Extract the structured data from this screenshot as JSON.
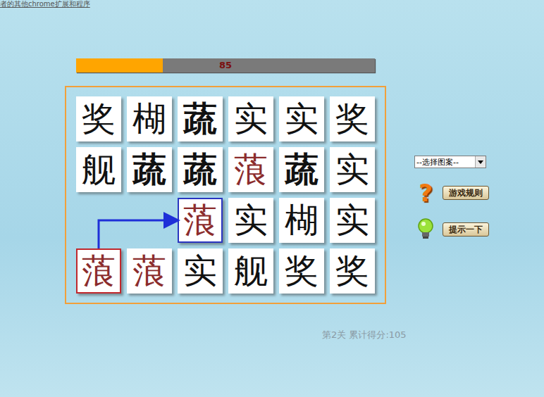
{
  "link": "者的其他chrome扩展和程序",
  "timer": {
    "level": 0.29,
    "reading": "85"
  },
  "board": {
    "columns": 6,
    "tiles": [
      {
        "kind": "tile",
        "char": "奖",
        "color": "#111111",
        "bold": false,
        "selected": false,
        "ring": ""
      },
      {
        "kind": "tile",
        "char": "楜",
        "color": "#111111",
        "bold": false,
        "selected": false,
        "ring": ""
      },
      {
        "kind": "tile",
        "char": "蔬",
        "color": "#111111",
        "bold": true,
        "selected": false,
        "ring": ""
      },
      {
        "kind": "tile",
        "char": "实",
        "color": "#111111",
        "bold": false,
        "selected": false,
        "ring": ""
      },
      {
        "kind": "tile",
        "char": "实",
        "color": "#111111",
        "bold": false,
        "selected": false,
        "ring": ""
      },
      {
        "kind": "tile",
        "char": "奖",
        "color": "#111111",
        "bold": false,
        "selected": false,
        "ring": ""
      },
      {
        "kind": "tile",
        "char": "舰",
        "color": "#111111",
        "bold": false,
        "selected": false,
        "ring": ""
      },
      {
        "kind": "tile",
        "char": "蔬",
        "color": "#111111",
        "bold": true,
        "selected": false,
        "ring": ""
      },
      {
        "kind": "tile",
        "char": "蔬",
        "color": "#111111",
        "bold": true,
        "selected": false,
        "ring": ""
      },
      {
        "kind": "tile",
        "char": "蒗",
        "color": "#8b2c2c",
        "bold": false,
        "selected": false,
        "ring": ""
      },
      {
        "kind": "tile",
        "char": "蔬",
        "color": "#111111",
        "bold": true,
        "selected": false,
        "ring": ""
      },
      {
        "kind": "tile",
        "char": "实",
        "color": "#111111",
        "bold": false,
        "selected": false,
        "ring": ""
      },
      {
        "kind": "empty",
        "char": "",
        "color": "",
        "bold": false,
        "selected": false,
        "ring": ""
      },
      {
        "kind": "empty",
        "char": "",
        "color": "",
        "bold": false,
        "selected": false,
        "ring": ""
      },
      {
        "kind": "tile",
        "char": "蒗",
        "color": "#8b2c2c",
        "bold": false,
        "selected": true,
        "ring": "#2a35c0"
      },
      {
        "kind": "tile",
        "char": "实",
        "color": "#111111",
        "bold": false,
        "selected": false,
        "ring": ""
      },
      {
        "kind": "tile",
        "char": "楜",
        "color": "#111111",
        "bold": false,
        "selected": false,
        "ring": ""
      },
      {
        "kind": "tile",
        "char": "实",
        "color": "#111111",
        "bold": false,
        "selected": false,
        "ring": ""
      },
      {
        "kind": "tile",
        "char": "蒗",
        "color": "#8b2c2c",
        "bold": false,
        "selected": true,
        "ring": "#c0282d"
      },
      {
        "kind": "tile",
        "char": "蒗",
        "color": "#8b2c2c",
        "bold": false,
        "selected": false,
        "ring": ""
      },
      {
        "kind": "tile",
        "char": "实",
        "color": "#111111",
        "bold": false,
        "selected": false,
        "ring": ""
      },
      {
        "kind": "tile",
        "char": "舰",
        "color": "#111111",
        "bold": false,
        "selected": false,
        "ring": ""
      },
      {
        "kind": "tile",
        "char": "奖",
        "color": "#111111",
        "bold": false,
        "selected": false,
        "ring": ""
      },
      {
        "kind": "tile",
        "char": "奖",
        "color": "#111111",
        "bold": false,
        "selected": false,
        "ring": ""
      }
    ]
  },
  "path": [
    [
      0,
      3
    ],
    [
      0,
      2
    ],
    [
      2,
      2
    ]
  ],
  "pattern_select": {
    "value": "--选择图案--"
  },
  "buttons": [
    {
      "kind": "rules",
      "glyph": "?",
      "label": "游戏规则"
    },
    {
      "kind": "hint",
      "glyph": "",
      "label": "提示一下"
    }
  ],
  "status": "第2关 累计得分:105"
}
